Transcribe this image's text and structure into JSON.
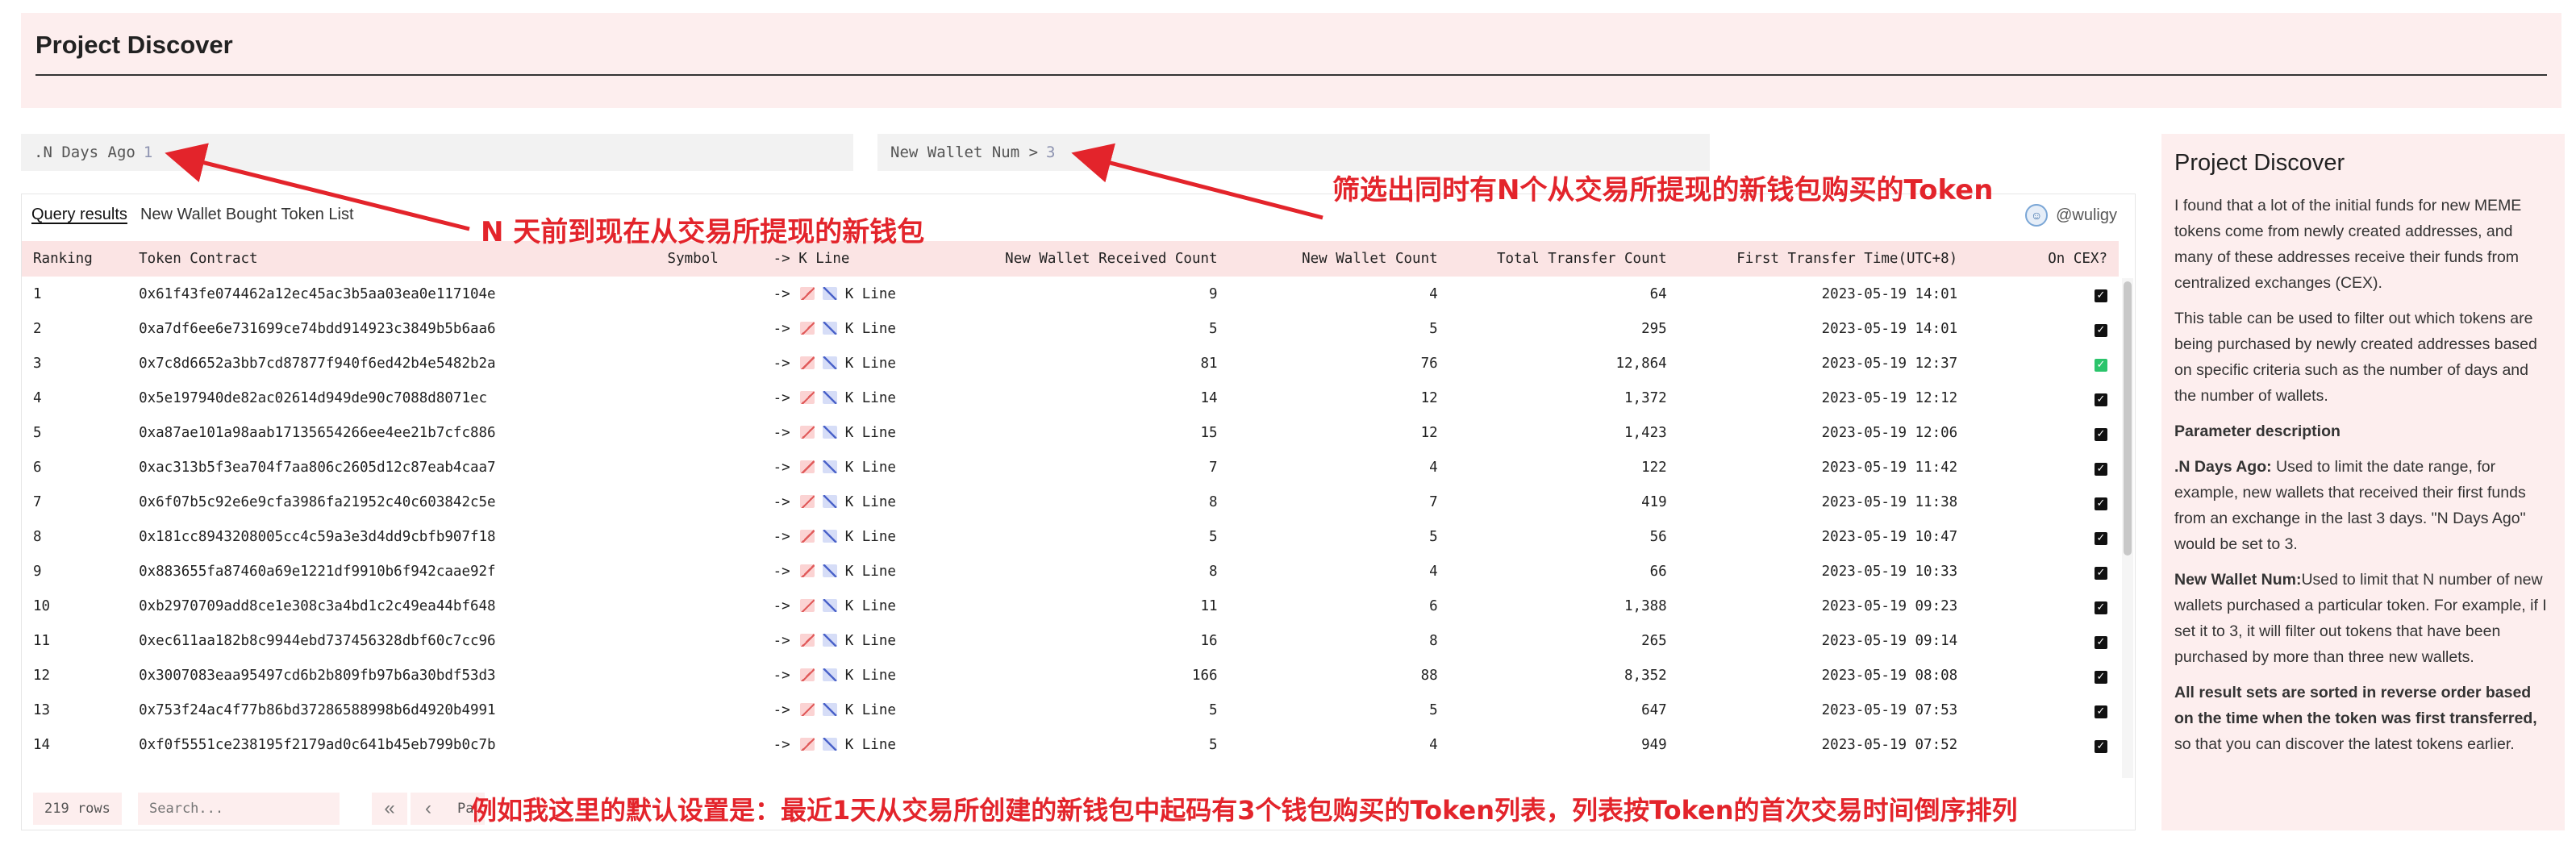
{
  "header": {
    "title": "Project Discover"
  },
  "params": {
    "days": {
      "label": ".N Days Ago",
      "value": "1"
    },
    "wallets": {
      "label": "New Wallet Num > ",
      "value": "3"
    }
  },
  "query": {
    "tabs": [
      {
        "label": "Query results",
        "active": true
      },
      {
        "label": "New Wallet Bought Token List",
        "active": false
      }
    ],
    "author": "@wuligy",
    "columns": [
      "Ranking",
      "Token Contract",
      "Symbol",
      "-> K Line",
      "New Wallet Received Count",
      "New Wallet Count",
      "Total Transfer Count",
      "First Transfer Time(UTC+8)",
      "On CEX?"
    ],
    "rows": [
      {
        "rank": "1",
        "contract": "0x61f43fe074462a12ec45ac3b5aa03ea0e117104e",
        "symbol": "",
        "arrow": "->",
        "kline": "K Line",
        "received": "9",
        "wallets": "4",
        "transfers": "64",
        "time": "2023-05-19 14:01",
        "cex": "checked-black"
      },
      {
        "rank": "2",
        "contract": "0xa7df6ee6e731699ce74bdd914923c3849b5b6aa6",
        "symbol": "",
        "arrow": "->",
        "kline": "K Line",
        "received": "5",
        "wallets": "5",
        "transfers": "295",
        "time": "2023-05-19 14:01",
        "cex": "checked-black"
      },
      {
        "rank": "3",
        "contract": "0x7c8d6652a3bb7cd87877f940f6ed42b4e5482b2a",
        "symbol": "",
        "arrow": "->",
        "kline": "K Line",
        "received": "81",
        "wallets": "76",
        "transfers": "12,864",
        "time": "2023-05-19 12:37",
        "cex": "checked-green"
      },
      {
        "rank": "4",
        "contract": "0x5e197940de82ac02614d949de90c7088d8071ec",
        "symbol": "",
        "arrow": "->",
        "kline": "K Line",
        "received": "14",
        "wallets": "12",
        "transfers": "1,372",
        "time": "2023-05-19 12:12",
        "cex": "checked-black"
      },
      {
        "rank": "5",
        "contract": "0xa87ae101a98aab17135654266ee4ee21b7cfc886",
        "symbol": "",
        "arrow": "->",
        "kline": "K Line",
        "received": "15",
        "wallets": "12",
        "transfers": "1,423",
        "time": "2023-05-19 12:06",
        "cex": "checked-black"
      },
      {
        "rank": "6",
        "contract": "0xac313b5f3ea704f7aa806c2605d12c87eab4caa7",
        "symbol": "",
        "arrow": "->",
        "kline": "K Line",
        "received": "7",
        "wallets": "4",
        "transfers": "122",
        "time": "2023-05-19 11:42",
        "cex": "checked-black"
      },
      {
        "rank": "7",
        "contract": "0x6f07b5c92e6e9cfa3986fa21952c40c603842c5e",
        "symbol": "",
        "arrow": "->",
        "kline": "K Line",
        "received": "8",
        "wallets": "7",
        "transfers": "419",
        "time": "2023-05-19 11:38",
        "cex": "checked-black"
      },
      {
        "rank": "8",
        "contract": "0x181cc8943208005cc4c59a3e3d4dd9cbfb907f18",
        "symbol": "",
        "arrow": "->",
        "kline": "K Line",
        "received": "5",
        "wallets": "5",
        "transfers": "56",
        "time": "2023-05-19 10:47",
        "cex": "checked-black"
      },
      {
        "rank": "9",
        "contract": "0x883655fa87460a69e1221df9910b6f942caae92f",
        "symbol": "",
        "arrow": "->",
        "kline": "K Line",
        "received": "8",
        "wallets": "4",
        "transfers": "66",
        "time": "2023-05-19 10:33",
        "cex": "checked-black"
      },
      {
        "rank": "10",
        "contract": "0xb2970709add8ce1e308c3a4bd1c2c49ea44bf648",
        "symbol": "",
        "arrow": "->",
        "kline": "K Line",
        "received": "11",
        "wallets": "6",
        "transfers": "1,388",
        "time": "2023-05-19 09:23",
        "cex": "checked-black"
      },
      {
        "rank": "11",
        "contract": "0xec611aa182b8c9944ebd737456328dbf60c7cc96",
        "symbol": "",
        "arrow": "->",
        "kline": "K Line",
        "received": "16",
        "wallets": "8",
        "transfers": "265",
        "time": "2023-05-19 09:14",
        "cex": "checked-black"
      },
      {
        "rank": "12",
        "contract": "0x3007083eaa95497cd6b2b809fb97b6a30bdf53d3",
        "symbol": "",
        "arrow": "->",
        "kline": "K Line",
        "received": "166",
        "wallets": "88",
        "transfers": "8,352",
        "time": "2023-05-19 08:08",
        "cex": "checked-black"
      },
      {
        "rank": "13",
        "contract": "0x753f24ac4f77b86bd37286588998b6d4920b4991",
        "symbol": "",
        "arrow": "->",
        "kline": "K Line",
        "received": "5",
        "wallets": "5",
        "transfers": "647",
        "time": "2023-05-19 07:53",
        "cex": "checked-black"
      },
      {
        "rank": "14",
        "contract": "0xf0f5551ce238195f2179ad0c641b45eb799b0c7b",
        "symbol": "",
        "arrow": "->",
        "kline": "K Line",
        "received": "5",
        "wallets": "4",
        "transfers": "949",
        "time": "2023-05-19 07:52",
        "cex": "checked-black"
      }
    ],
    "footer": {
      "rows_label": "219 rows",
      "search_placeholder": "Search...",
      "page_label": "Pa"
    }
  },
  "info": {
    "title": "Project Discover",
    "p1": "I found that a lot of the initial funds for new MEME tokens come from newly created addresses, and many of these addresses receive their funds from centralized exchanges (CEX).",
    "p2": "This table can be used to filter out which tokens are being purchased by newly created addresses based on specific criteria such as the number of days and the number of wallets.",
    "param_heading": "Parameter description",
    "p3_term": ".N Days Ago:",
    "p3_text": " Used to limit the date range, for example, new wallets that received their first funds from an exchange in the last 3 days. \"N Days Ago\" would be set to 3.",
    "p4_term": "New Wallet Num:",
    "p4_text": "Used to limit that N number of new wallets purchased a particular token. For example, if I set it to 3, it will filter out tokens that have been purchased by more than three new wallets.",
    "p5_bold": "All result sets are sorted in reverse order based on the time when the token was first transferred,",
    "p5_text": " so that you can discover the latest tokens earlier."
  },
  "annotations": {
    "a1": "N 天前到现在从交易所提现的新钱包",
    "a2": "筛选出同时有N个从交易所提现的新钱包购买的Token",
    "a3": "例如我这里的默认设置是：最近1天从交易所创建的新钱包中起码有3个钱包购买的Token列表，列表按Token的首次交易时间倒序排列"
  },
  "colors": {
    "accent_bg": "#fdeeee",
    "header_row": "#fbe4e4",
    "annotation": "#e3242b",
    "link": "#5b6395",
    "green_check": "#2bc46b"
  }
}
